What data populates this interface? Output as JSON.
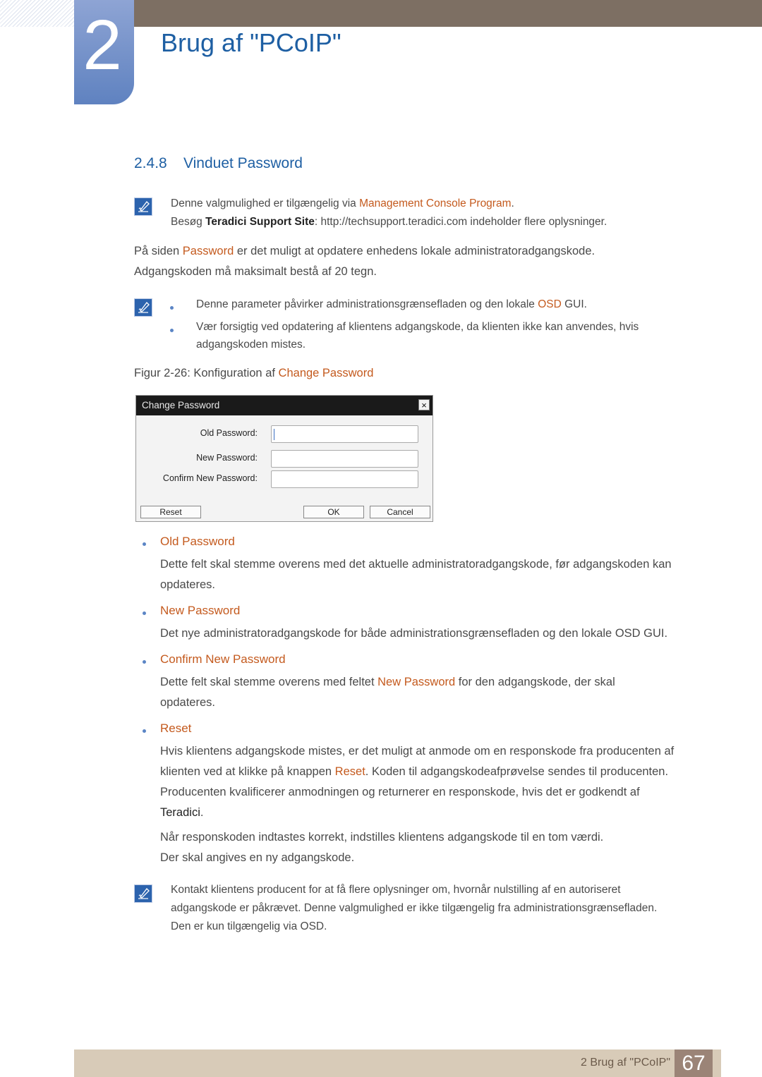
{
  "header": {
    "chapter_number": "2",
    "chapter_title": "Brug af \"PCoIP\""
  },
  "section": {
    "number": "2.4.8",
    "title": "Vinduet Password"
  },
  "note1": {
    "icon": "note-pen-icon",
    "line1_pre": "Denne valgmulighed er tilgængelig via ",
    "line1_hl": "Management Console Program",
    "line1_post": ".",
    "line2_pre": "Besøg ",
    "line2_bold": "Teradici Support Site",
    "line2_post": ": http://techsupport.teradici.com indeholder flere oplysninger."
  },
  "intro": {
    "line1_pre": "På siden ",
    "line1_hl": "Password",
    "line1_post": " er det muligt at opdatere enhedens lokale administratoradgangskode.",
    "line2": "Adgangskoden må maksimalt bestå af 20 tegn."
  },
  "note2": {
    "icon": "note-pen-icon",
    "bullet1_pre": "Denne parameter påvirker administrationsgrænsefladen og den lokale ",
    "bullet1_hl": "OSD",
    "bullet1_post": " GUI.",
    "bullet2_line1": "Vær forsigtig ved opdatering af klientens adgangskode, da klienten ikke kan anvendes, hvis",
    "bullet2_line2": "adgangskoden mistes."
  },
  "figure": {
    "caption_pre": "Figur 2-26: Konfiguration af ",
    "caption_hl": "Change Password"
  },
  "dialog": {
    "title": "Change Password",
    "close_label": "×",
    "fields": [
      {
        "label": "Old Password:",
        "value": ""
      },
      {
        "label": "New Password:",
        "value": ""
      },
      {
        "label": "Confirm New Password:",
        "value": ""
      }
    ],
    "reset_label": "Reset",
    "ok_label": "OK",
    "cancel_label": "Cancel"
  },
  "items": {
    "old": {
      "title": "Old Password",
      "line1": "Dette felt skal stemme overens med det aktuelle administratoradgangskode, før adgangskoden kan",
      "line2": "opdateres."
    },
    "new": {
      "title": "New Password",
      "line1": "Det nye administratoradgangskode for både administrationsgrænsefladen og den lokale OSD GUI."
    },
    "confirm": {
      "title": "Confirm New Password",
      "line1_pre": "Dette felt skal stemme overens med feltet ",
      "line1_hl": "New Password",
      "line1_post": " for den adgangskode, der skal",
      "line2": "opdateres."
    },
    "reset": {
      "title": "Reset",
      "line1": "Hvis klientens adgangskode mistes, er det muligt at anmode om en responskode fra producenten af",
      "line2_pre": "klienten ved at klikke på knappen ",
      "line2_hl": "Reset",
      "line2_post": ". Koden til adgangskodeafprøvelse sendes til producenten.",
      "line3": "Producenten kvalificerer anmodningen og returnerer en responskode, hvis det er godkendt af",
      "line4_bold": "Teradici",
      "line4_post": ".",
      "line5": "Når responskoden indtastes korrekt, indstilles klientens adgangskode til en tom værdi.",
      "line6": "Der skal angives en ny adgangskode."
    }
  },
  "note3": {
    "icon": "note-pen-icon",
    "line1": "Kontakt klientens producent for at få flere oplysninger om, hvornår nulstilling af en autoriseret",
    "line2": "adgangskode er påkrævet. Denne valgmulighed er ikke tilgængelig fra administrationsgrænsefladen.",
    "line3": "Den er kun tilgængelig via OSD."
  },
  "footer": {
    "text": "2 Brug af \"PCoIP\"",
    "page_number": "67"
  },
  "colors": {
    "heading_blue": "#1e5fa3",
    "highlight_orange": "#c45a1e",
    "topbar_brown": "#7d6f63",
    "footer_tan": "#d8cbb8",
    "page_num_bg": "#9b8477"
  }
}
